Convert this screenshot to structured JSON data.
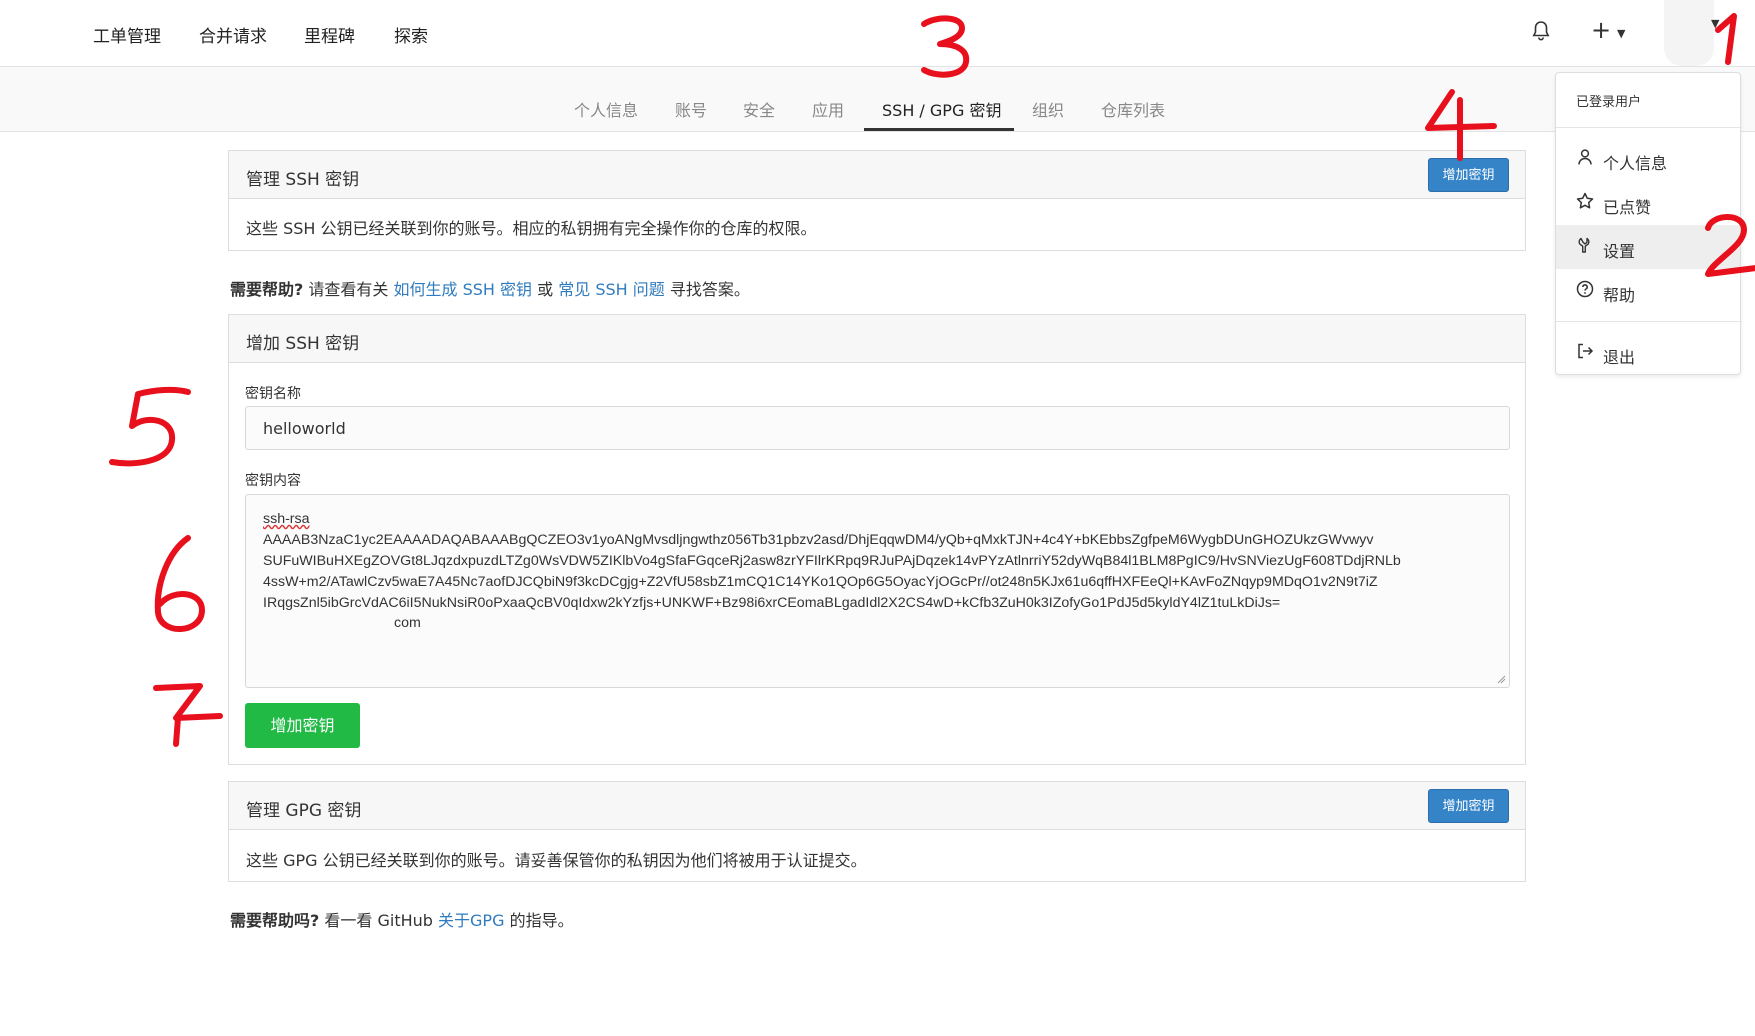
{
  "top_nav": {
    "items": [
      "工单管理",
      "合并请求",
      "里程碑",
      "探索"
    ]
  },
  "settings_tabs": {
    "items": [
      "个人信息",
      "账号",
      "安全",
      "应用",
      "SSH / GPG 密钥",
      "组织",
      "仓库列表"
    ],
    "active": "SSH / GPG 密钥"
  },
  "ssh_manage": {
    "title": "管理 SSH 密钥",
    "add_button": "增加密钥",
    "description": "这些 SSH 公钥已经关联到你的账号。相应的私钥拥有完全操作你的仓库的权限。"
  },
  "ssh_help": {
    "bold": "需要帮助?",
    "text1": "请查看有关",
    "link1": "如何生成 SSH 密钥",
    "text2": "或",
    "link2": "常见 SSH 问题",
    "text3": "寻找答案。"
  },
  "add_ssh": {
    "title": "增加 SSH 密钥",
    "name_label": "密钥名称",
    "name_value": "helloworld",
    "content_label": "密钥内容",
    "content_lines": [
      "ssh-rsa",
      "AAAAB3NzaC1yc2EAAAADAQABAAABgQCZEO3v1yoANgMvsdljngwthz056Tb31pbzv2asd/DhjEqqwDM4/yQb+qMxkTJN+4c4Y+bKEbbsZgfpeM6WygbDUnGHOZUkzGWvwyv",
      "SUFuWIBuHXEgZOVGt8LJqzdxpuzdLTZg0WsVDW5ZIKlbVo4gSfaFGqceRj2asw8zrYFIlrKRpq9RJuPAjDqzek14vPYzAtlnrriY52dyWqB84l1BLM8PgIC9/HvSNViezUgF608TDdjRNLb",
      "4ssW+m2/ATawlCzv5waE7A45Nc7aofDJCQbiN9f3kcDCgjg+Z2VfU58sbZ1mCQ1C14YKo1QOp6G5OyacYjOGcPr//ot248n5KJx61u6qffHXFEeQl+KAvFoZNqyp9MDqO1v2N9t7iZ",
      "IRqgsZnl5ibGrcVdAC6iI5NukNsiR0oPxaaQcBV0qIdxw2kYzfjs+UNKWF+Bz98i6xrCEomaBLgadIdl2X2CS4wD+kCfb3ZuH0k3IZofyGo1PdJ5d5kyldY4lZ1tuLkDiJs=",
      "com"
    ],
    "submit_button": "增加密钥"
  },
  "gpg_manage": {
    "title": "管理 GPG 密钥",
    "add_button": "增加密钥",
    "description": "这些 GPG 公钥已经关联到你的账号。请妥善保管你的私钥因为他们将被用于认证提交。"
  },
  "gpg_help": {
    "bold": "需要帮助吗?",
    "text1": "看一看 GitHub",
    "link1": "关于GPG",
    "text2": "的指导。"
  },
  "user_menu": {
    "header": "已登录用户",
    "items": [
      {
        "label": "个人信息",
        "icon": "person-icon"
      },
      {
        "label": "已点赞",
        "icon": "star-icon"
      },
      {
        "label": "设置",
        "icon": "wrench-icon",
        "highlighted": true
      },
      {
        "label": "帮助",
        "icon": "help-circle-icon"
      },
      {
        "label": "退出",
        "icon": "sign-out-icon"
      }
    ]
  },
  "annotations": [
    "1",
    "2",
    "3",
    "4",
    "5",
    "6",
    "7"
  ],
  "colors": {
    "primary_blue": "#3584c8",
    "green": "#21ba45",
    "link": "#2f7bbf",
    "annotation_red": "#e8101c"
  }
}
